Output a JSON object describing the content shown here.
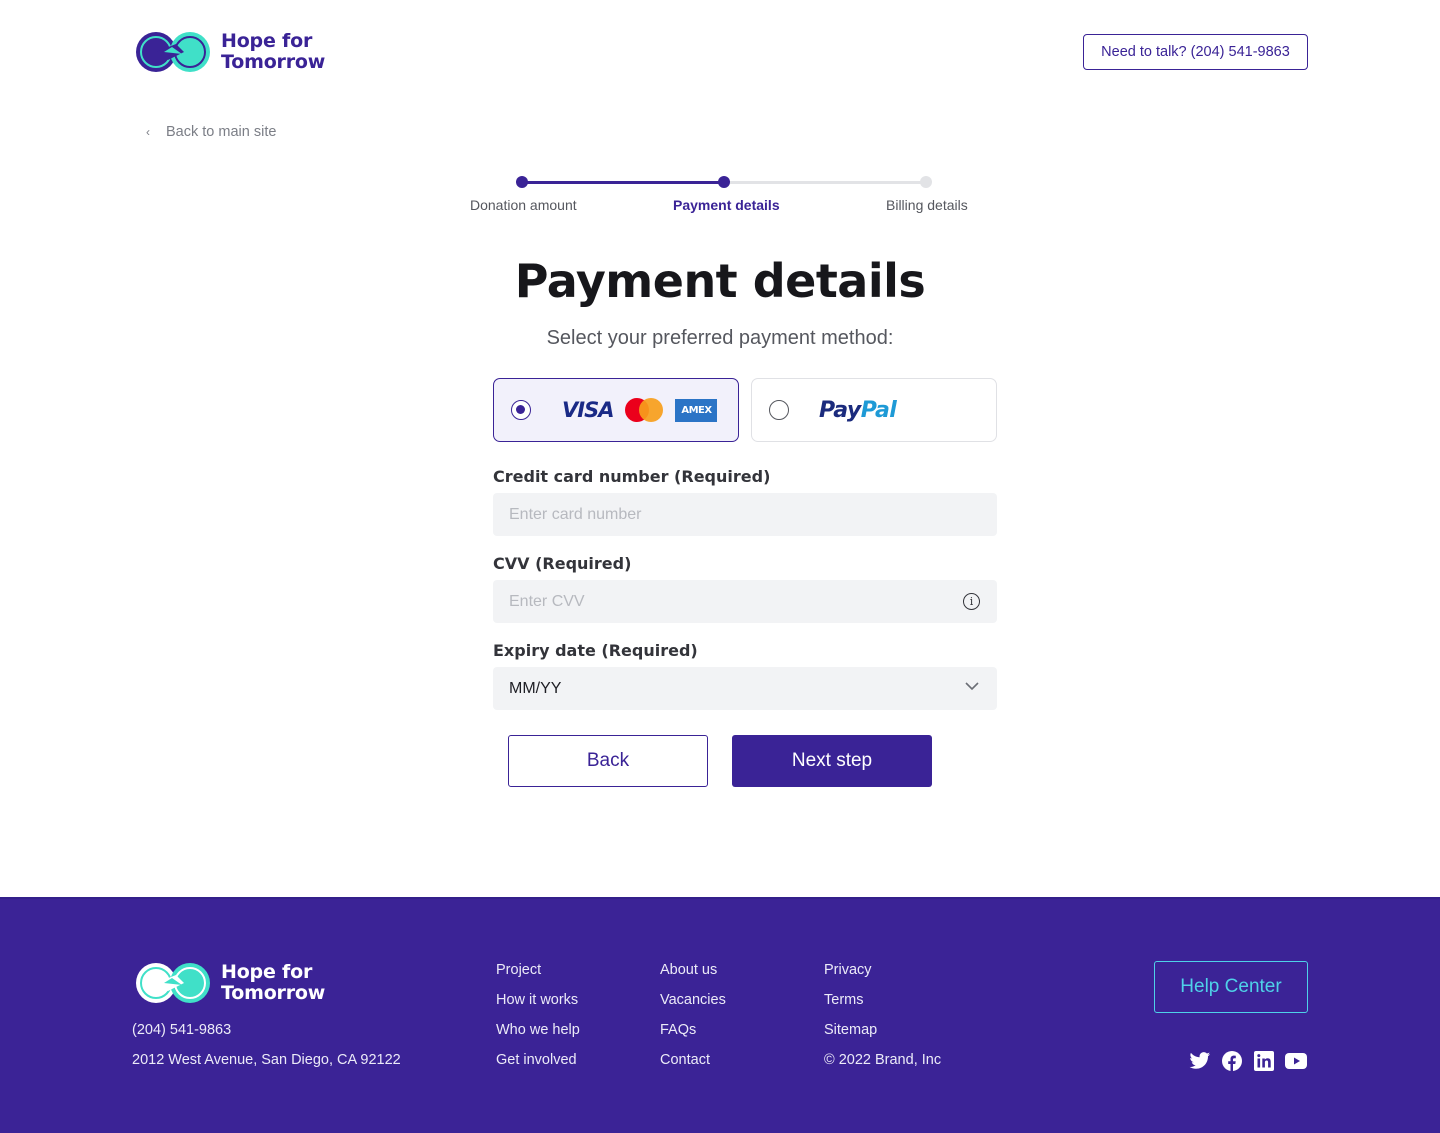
{
  "brand": {
    "name_line1": "Hope for",
    "name_line2": "Tomorrow",
    "colors": {
      "primary": "#3a2396",
      "accent": "#4fd1e8",
      "teal": "#40e0c8"
    }
  },
  "header": {
    "talk_button": "Need to talk? (204) 541-9863",
    "back_link": "Back to main site",
    "back_icon": "chevron-left-icon"
  },
  "stepper": {
    "current_step": 2,
    "total_steps": 3,
    "steps": [
      {
        "label": "Donation amount",
        "status": "done"
      },
      {
        "label": "Payment details",
        "status": "active"
      },
      {
        "label": "Billing details",
        "status": "todo"
      }
    ]
  },
  "main": {
    "title": "Payment details",
    "subtitle": "Select your preferred payment method:",
    "methods": [
      {
        "id": "card",
        "selected": true,
        "logos": [
          "VISA",
          "Mastercard",
          "AMEX"
        ]
      },
      {
        "id": "paypal",
        "selected": false,
        "logo_pay": "Pay",
        "logo_pal": "Pal"
      }
    ],
    "fields": {
      "card_number": {
        "label": "Credit card number (Required)",
        "placeholder": "Enter card number",
        "value": ""
      },
      "cvv": {
        "label": "CVV (Required)",
        "placeholder": "Enter CVV",
        "value": "",
        "icon": "info-icon"
      },
      "expiry": {
        "label": "Expiry date (Required)",
        "value": "MM/YY",
        "icon": "chevron-down-icon"
      }
    },
    "back_button": "Back",
    "next_button": "Next step"
  },
  "footer": {
    "phone": "(204) 541-9863",
    "address": "2012 West Avenue, San Diego, CA 92122",
    "columns": [
      [
        "Project",
        "How it works",
        "Who we help",
        "Get involved"
      ],
      [
        "About us",
        "Vacancies",
        "FAQs",
        "Contact"
      ],
      [
        "Privacy",
        "Terms",
        "Sitemap",
        "© 2022 Brand, Inc"
      ]
    ],
    "help_button": "Help Center",
    "social": [
      "twitter-icon",
      "facebook-icon",
      "linkedin-icon",
      "youtube-icon"
    ]
  }
}
